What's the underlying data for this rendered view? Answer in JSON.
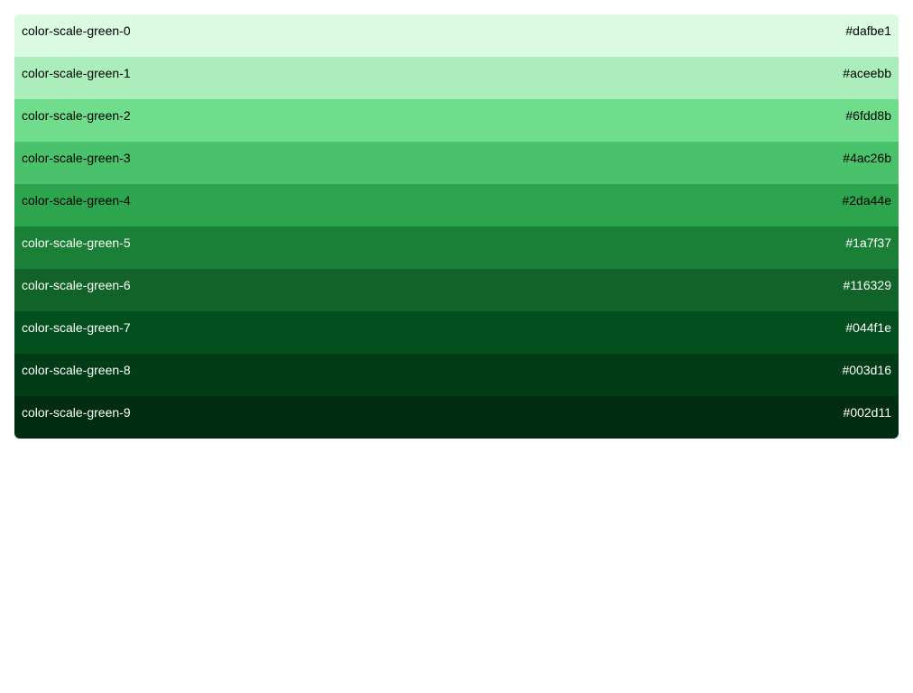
{
  "swatches": [
    {
      "name": "color-scale-green-0",
      "hex": "#dafbe1",
      "text_color": "#000000"
    },
    {
      "name": "color-scale-green-1",
      "hex": "#aceebb",
      "text_color": "#000000"
    },
    {
      "name": "color-scale-green-2",
      "hex": "#6fdd8b",
      "text_color": "#000000"
    },
    {
      "name": "color-scale-green-3",
      "hex": "#4ac26b",
      "text_color": "#000000"
    },
    {
      "name": "color-scale-green-4",
      "hex": "#2da44e",
      "text_color": "#000000"
    },
    {
      "name": "color-scale-green-5",
      "hex": "#1a7f37",
      "text_color": "#ffffff"
    },
    {
      "name": "color-scale-green-6",
      "hex": "#116329",
      "text_color": "#ffffff"
    },
    {
      "name": "color-scale-green-7",
      "hex": "#044f1e",
      "text_color": "#ffffff"
    },
    {
      "name": "color-scale-green-8",
      "hex": "#003d16",
      "text_color": "#ffffff"
    },
    {
      "name": "color-scale-green-9",
      "hex": "#002d11",
      "text_color": "#ffffff"
    }
  ]
}
